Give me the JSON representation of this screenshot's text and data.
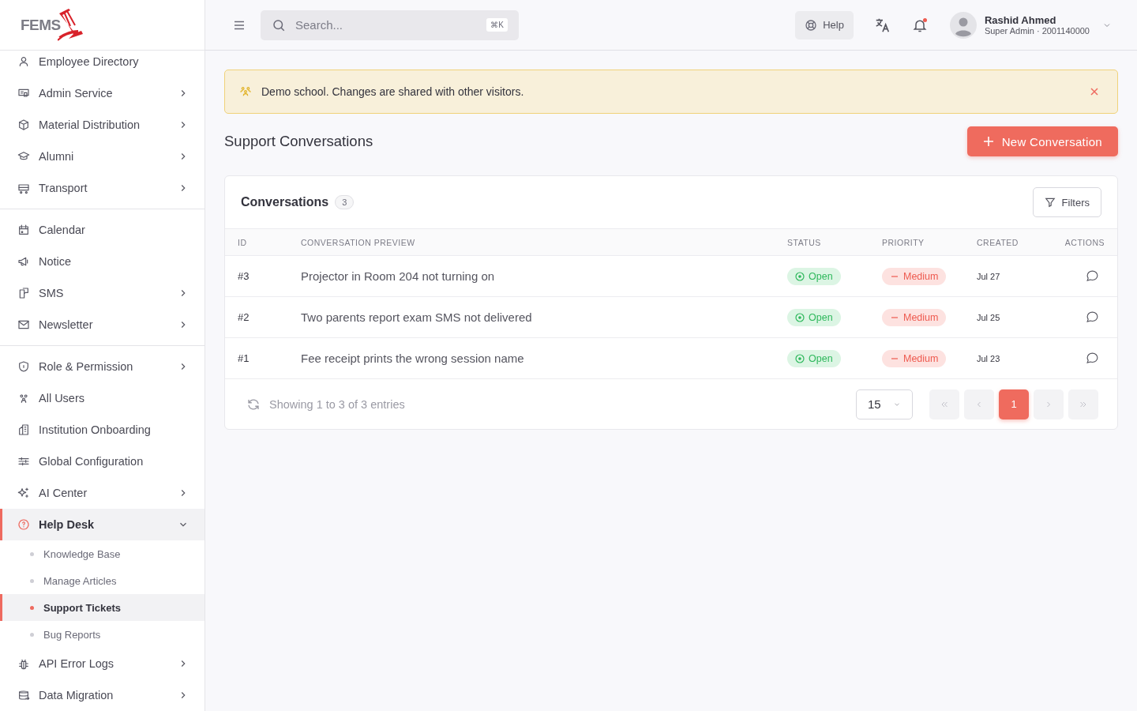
{
  "brand": {
    "logo": "FEMS"
  },
  "sidebar": {
    "groups": [
      {
        "items": [
          {
            "label": "Employee Directory",
            "submenu": false,
            "selected": false
          },
          {
            "label": "Admin Service",
            "submenu": true,
            "expanded": false,
            "selected": false
          },
          {
            "label": "Material Distribution",
            "submenu": true,
            "expanded": false,
            "selected": false
          },
          {
            "label": "Alumni",
            "submenu": true,
            "expanded": false,
            "selected": false
          },
          {
            "label": "Transport",
            "submenu": true,
            "expanded": false,
            "selected": false
          }
        ]
      },
      {
        "items": [
          {
            "label": "Calendar",
            "submenu": false,
            "selected": false
          },
          {
            "label": "Notice",
            "submenu": false,
            "selected": false
          },
          {
            "label": "SMS",
            "submenu": true,
            "expanded": false,
            "selected": false
          },
          {
            "label": "Newsletter",
            "submenu": true,
            "expanded": false,
            "selected": false
          }
        ]
      },
      {
        "items": [
          {
            "label": "Role & Permission",
            "submenu": true,
            "expanded": false,
            "selected": false
          },
          {
            "label": "All Users",
            "submenu": false,
            "selected": false
          },
          {
            "label": "Institution Onboarding",
            "submenu": false,
            "selected": false
          },
          {
            "label": "Global Configuration",
            "submenu": false,
            "selected": false
          },
          {
            "label": "AI Center",
            "submenu": true,
            "expanded": false,
            "selected": false
          },
          {
            "label": "Help Desk",
            "submenu": true,
            "expanded": true,
            "selected": true,
            "children": [
              {
                "label": "Knowledge Base",
                "selected": false
              },
              {
                "label": "Manage Articles",
                "selected": false
              },
              {
                "label": "Support Tickets",
                "selected": true
              },
              {
                "label": "Bug Reports",
                "selected": false
              }
            ]
          },
          {
            "label": "API Error Logs",
            "submenu": true,
            "expanded": false,
            "selected": false
          },
          {
            "label": "Data Migration",
            "submenu": true,
            "expanded": false,
            "selected": false
          }
        ]
      }
    ]
  },
  "topbar": {
    "search": {
      "placeholder": "Search...",
      "shortcut": "⌘K"
    },
    "help": "Help",
    "notifications_unread": true,
    "user": {
      "name": "Rashid Ahmed",
      "role": "Super Admin · 2001140000"
    }
  },
  "banner": {
    "text": "Demo school. Changes are shared with other visitors."
  },
  "page": {
    "title": "Support Conversations",
    "new_button": "New Conversation"
  },
  "card": {
    "title": "Conversations",
    "count": "3",
    "filters": "Filters",
    "table": {
      "columns": [
        "ID",
        "CONVERSATION PREVIEW",
        "STATUS",
        "PRIORITY",
        "CREATED",
        "ACTIONS"
      ],
      "rows": [
        {
          "id": "#3",
          "preview": "Projector in Room 204 not turning on",
          "status": {
            "label": "Open",
            "kind": "open"
          },
          "priority": {
            "label": "Medium",
            "kind": "medium"
          },
          "created": "Jul 27"
        },
        {
          "id": "#2",
          "preview": "Two parents report exam SMS not delivered",
          "status": {
            "label": "Open",
            "kind": "open"
          },
          "priority": {
            "label": "Medium",
            "kind": "medium"
          },
          "created": "Jul 25"
        },
        {
          "id": "#1",
          "preview": "Fee receipt prints the wrong session name",
          "status": {
            "label": "Open",
            "kind": "open"
          },
          "priority": {
            "label": "Medium",
            "kind": "medium"
          },
          "created": "Jul 23"
        }
      ]
    },
    "footer": {
      "summary": "Showing 1 to 3 of 3 entries",
      "page_size": "15",
      "pages": [
        {
          "label": "1",
          "selected": true
        }
      ]
    }
  }
}
